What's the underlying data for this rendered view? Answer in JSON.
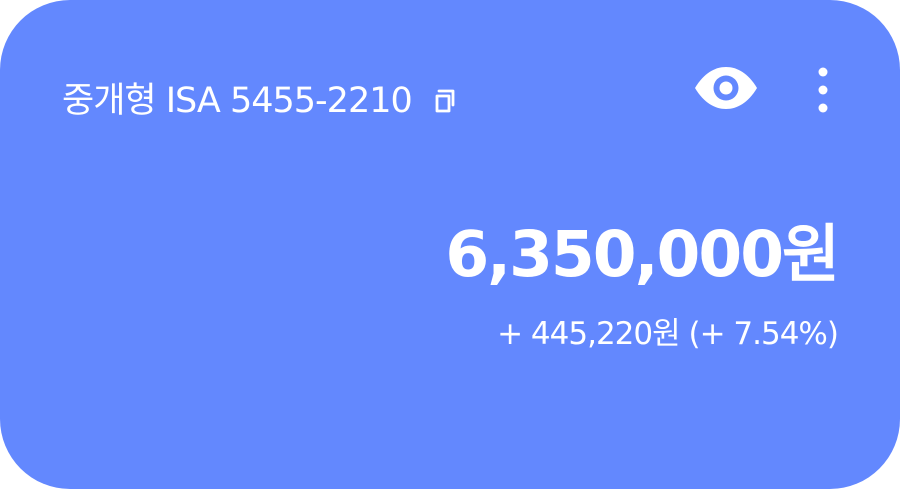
{
  "account": {
    "name": "중개형 ISA 5455-2210"
  },
  "icons": {
    "copy": "copy-icon",
    "visibility": "eye-icon",
    "menu": "more-vertical-icon"
  },
  "balance": {
    "amount": "6,350,000원",
    "change": "+ 445,220원 (+ 7.54%)"
  },
  "colors": {
    "card_background": "#6388fe",
    "text": "#ffffff"
  }
}
